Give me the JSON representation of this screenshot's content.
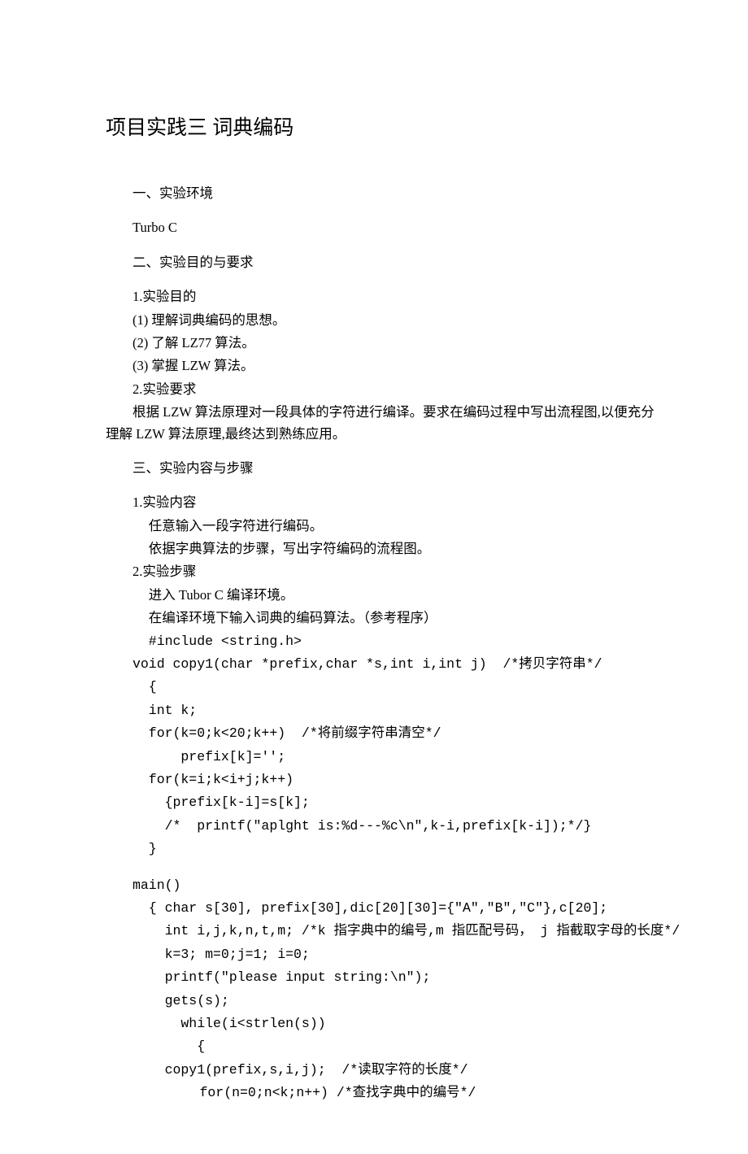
{
  "title": "项目实践三 词典编码",
  "sec1": {
    "heading": "一、实验环境",
    "env": "Turbo C"
  },
  "sec2": {
    "heading": "二、实验目的与要求",
    "p1": "1.实验目的",
    "p1a": "(1) 理解词典编码的思想。",
    "p1b": "(2) 了解 LZ77 算法。",
    "p1c": "(3) 掌握 LZW 算法。",
    "p2": "2.实验要求",
    "p2a": "根据 LZW 算法原理对一段具体的字符进行编译。要求在编码过程中写出流程图,以便充分理解 LZW 算法原理,最终达到熟练应用。"
  },
  "sec3": {
    "heading": "三、实验内容与步骤",
    "p1": "1.实验内容",
    "p1a": "任意输入一段字符进行编码。",
    "p1b": "依据字典算法的步骤，写出字符编码的流程图。",
    "p2": "2.实验步骤",
    "p2a": "进入 Tubor C 编译环境。",
    "p2b": "在编译环境下输入词典的编码算法。（参考程序）"
  },
  "code": {
    "l01": "#include <string.h>",
    "l02": "void copy1(char *prefix,char *s,int i,int j)  /*拷贝字符串*/",
    "l03": "{",
    "l04": "int k;",
    "l05": "for(k=0;k<20;k++)  /*将前缀字符串清空*/",
    "l06": "prefix[k]='';",
    "l07": "for(k=i;k<i+j;k++)",
    "l08": "{prefix[k-i]=s[k];",
    "l09": "/*  printf(\"aplght is:%d---%c\\n\",k-i,prefix[k-i]);*/}",
    "l10": "}",
    "l11": "main()",
    "l12": "{ char s[30], prefix[30],dic[20][30]={\"A\",\"B\",\"C\"},c[20];",
    "l13": "int i,j,k,n,t,m; /*k 指字典中的编号,m 指匹配号码， j 指截取字母的长度*/",
    "l14": "k=3; m=0;j=1; i=0;",
    "l15": "printf(\"please input string:\\n\");",
    "l16": "gets(s);",
    "l17": "while(i<strlen(s))",
    "l18": "{",
    "l19": "copy1(prefix,s,i,j);  /*读取字符的长度*/",
    "l20": "for(n=0;n<k;n++) /*查找字典中的编号*/"
  }
}
